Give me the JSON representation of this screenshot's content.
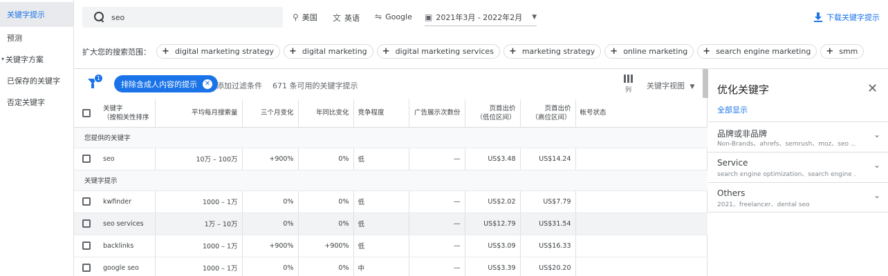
{
  "nav": {
    "items": [
      {
        "label": "关键字提示",
        "active": true
      },
      {
        "label": "预测"
      },
      {
        "label": "关键字方案",
        "caret": "▾"
      },
      {
        "label": "已保存的关键字"
      },
      {
        "label": "否定关键字"
      }
    ]
  },
  "topbar": {
    "search_value": "seo",
    "location": "美国",
    "language": "英语",
    "network": "Google",
    "date_range": "2021年3月 - 2022年2月",
    "download": "下载关键字提示"
  },
  "broaden": {
    "label": "扩大您的搜索范围：",
    "chips": [
      "digital marketing strategy",
      "digital marketing",
      "digital marketing services",
      "marketing strategy",
      "online marketing",
      "search engine marketing",
      "smm"
    ]
  },
  "filterbar": {
    "filter_badge": "1",
    "active_filter": "排除含成人内容的提示",
    "add_filter": "添加过滤条件",
    "count_text": "671 条可用的关键字提示",
    "columns_label": "列",
    "view_label": "关键字视图"
  },
  "table": {
    "headers": {
      "keyword": "关键字",
      "keyword_sort": "（按相关性排序",
      "avg_monthly": "平均每月搜索量",
      "three_month": "三个月变化",
      "yoy": "年同比变化",
      "competition": "竞争程度",
      "ad_impr": "广告展示次数份",
      "bid_low": "页首出价",
      "bid_low_sub": "（低位区间）",
      "bid_high": "页首出价",
      "bid_high_sub": "（高位区间）",
      "account_status": "帐号状态"
    },
    "section_provided": "您提供的关键字",
    "section_ideas": "关键字提示",
    "provided": [
      {
        "keyword": "seo",
        "avg": "10万 – 100万",
        "three": "+900%",
        "yoy": "0%",
        "comp": "低",
        "impr": "—",
        "low": "US$3.48",
        "high": "US$14.24"
      }
    ],
    "ideas": [
      {
        "keyword": "kwfinder",
        "avg": "1000 – 1万",
        "three": "0%",
        "yoy": "0%",
        "comp": "低",
        "impr": "—",
        "low": "US$2.02",
        "high": "US$7.79"
      },
      {
        "keyword": "seo services",
        "avg": "1万 – 10万",
        "three": "0%",
        "yoy": "0%",
        "comp": "低",
        "impr": "—",
        "low": "US$12.79",
        "high": "US$31.54"
      },
      {
        "keyword": "backlinks",
        "avg": "1000 – 1万",
        "three": "+900%",
        "yoy": "+900%",
        "comp": "低",
        "impr": "—",
        "low": "US$3.09",
        "high": "US$16.33"
      },
      {
        "keyword": "google seo",
        "avg": "1000 – 1万",
        "three": "0%",
        "yoy": "0%",
        "comp": "中",
        "impr": "—",
        "low": "US$3.39",
        "high": "US$20.20"
      }
    ]
  },
  "panel": {
    "title": "优化关键字",
    "show_all": "全部显示",
    "groups": [
      {
        "title": "品牌或非品牌",
        "sub": "Non-Brands、ahrefs、semrush、moz、seo ..."
      },
      {
        "title": "Service",
        "sub": "search engine optimization、search engine ..."
      },
      {
        "title": "Others",
        "sub": "2021、freelancer、dental seo"
      }
    ]
  },
  "colors": {
    "accent": "#1a73e8",
    "highlight_row": "#f1f3f4"
  }
}
